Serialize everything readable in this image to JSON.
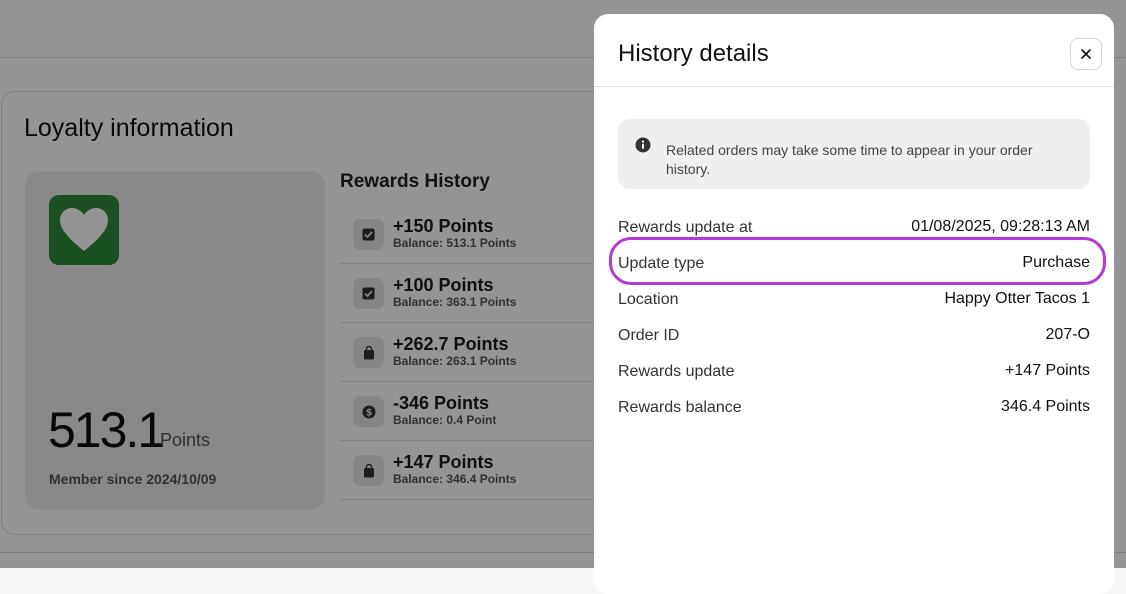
{
  "loyalty": {
    "title": "Loyalty information",
    "points_value": "513.1",
    "points_unit": "Points",
    "member_since": "Member since 2024/10/09",
    "brand_color": "#2f8a3c",
    "logo_icon": "heart-icon"
  },
  "rewards_history": {
    "title": "Rewards History",
    "items": [
      {
        "points": "+150 Points",
        "balance": "Balance: 513.1 Points",
        "icon": "checkbox-icon"
      },
      {
        "points": "+100 Points",
        "balance": "Balance: 363.1 Points",
        "icon": "checkbox-icon"
      },
      {
        "points": "+262.7 Points",
        "balance": "Balance: 263.1 Points",
        "icon": "shopping-bag-icon"
      },
      {
        "points": "-346 Points",
        "balance": "Balance: 0.4 Point",
        "icon": "dollar-icon"
      },
      {
        "points": "+147 Points",
        "balance": "Balance: 346.4 Points",
        "icon": "shopping-bag-icon"
      }
    ]
  },
  "modal": {
    "title": "History details",
    "close_icon": "close-icon",
    "info_text": "Related orders may take some time to appear in your order history.",
    "details": [
      {
        "label": "Rewards update at",
        "value": "01/08/2025, 09:28:13 AM"
      },
      {
        "label": "Update type",
        "value": "Purchase"
      },
      {
        "label": "Location",
        "value": "Happy Otter Tacos 1"
      },
      {
        "label": "Order ID",
        "value": "207-O"
      },
      {
        "label": "Rewards update",
        "value": "+147 Points"
      },
      {
        "label": "Rewards balance",
        "value": "346.4 Points"
      }
    ],
    "highlight_color": "#b13ad8"
  }
}
